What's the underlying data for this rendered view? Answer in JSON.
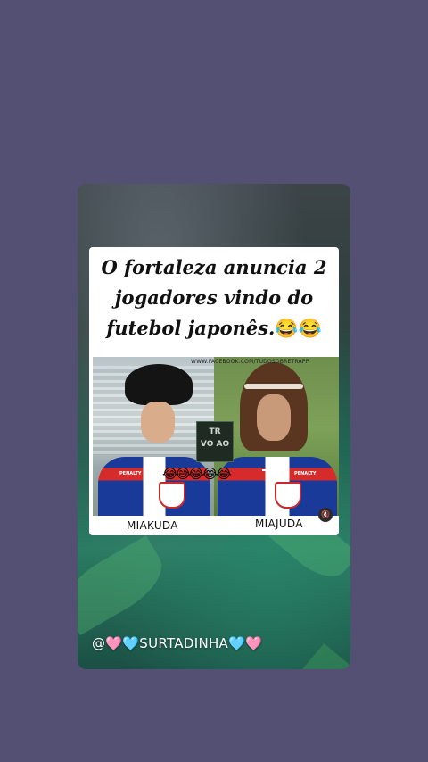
{
  "post": {
    "headline_line1": "O fortaleza anuncia 2",
    "headline_line2": "jogadores vindo do",
    "headline_line3": "futebol japonês.",
    "headline_emoji": "😂😂",
    "watermark": "WWW.FACEBOOK.COM/TUDOSOBRETRAPP",
    "center_logo": "TR\nVO AO",
    "reaction_emojis": "😂😅😂😂😂",
    "left_name": "MIAKUDA",
    "right_name": "MIAJUDA",
    "sponsor": "PENALTY"
  },
  "overlay": {
    "handle_at": "@",
    "handle_name": "SURTADINHA",
    "heart_pink": "🩷",
    "heart_blue": "🩵"
  },
  "icons": {
    "mute": "speaker-muted-icon"
  },
  "colors": {
    "background": "#545073",
    "jersey_blue": "#1a3a9a",
    "jersey_red": "#d52b2b"
  }
}
